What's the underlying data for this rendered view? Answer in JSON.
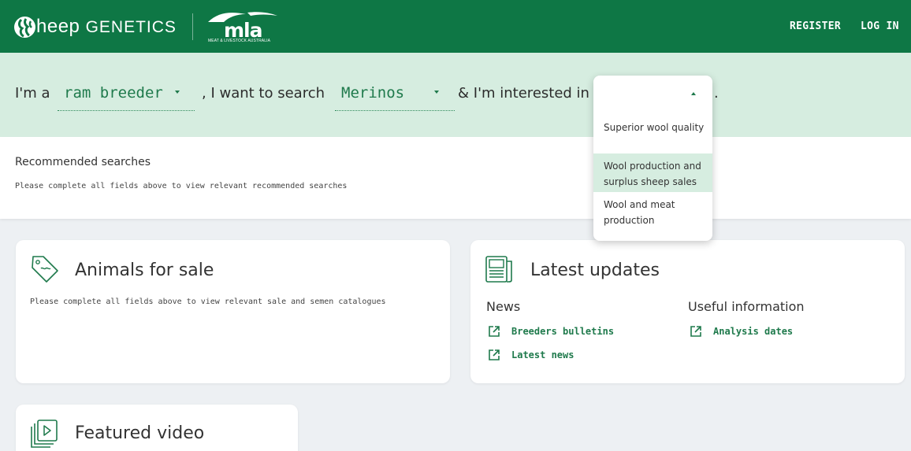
{
  "header": {
    "brand_lead": "heep",
    "brand_tail": "GENETICS",
    "mla_word": "mla",
    "mla_sub": "MEAT & LIVESTOCK AUSTRALIA",
    "register": "REGISTER",
    "login": "LOG IN",
    "color": "#0e7745"
  },
  "filter": {
    "prefix": "I'm a",
    "role_value": "ram breeder",
    "mid": ", I want to search",
    "breed_value": "Merinos",
    "tail": "& I'm interested in",
    "end": ".",
    "band_color": "#d6ede0"
  },
  "dropdown": {
    "options": [
      {
        "label": "Superior wool quality",
        "selected": false
      },
      {
        "label": "Wool production and surplus sheep sales",
        "selected": true
      },
      {
        "label": "Wool and meat production",
        "selected": false
      }
    ]
  },
  "recommended": {
    "title": "Recommended searches",
    "note": "Please complete all fields above to view relevant recommended searches"
  },
  "animals": {
    "title": "Animals for sale",
    "note": "Please complete all fields above to view relevant sale and semen catalogues"
  },
  "updates": {
    "title": "Latest updates",
    "news_heading": "News",
    "news_links": [
      "Breeders bulletins",
      "Latest news"
    ],
    "info_heading": "Useful information",
    "info_links": [
      "Analysis dates"
    ]
  },
  "video": {
    "title": "Featured video"
  },
  "icons": {
    "brand": "sheep-logo-icon",
    "tag": "price-tag-icon",
    "newspaper": "newspaper-icon",
    "external": "external-link-icon",
    "video": "video-stack-icon"
  }
}
